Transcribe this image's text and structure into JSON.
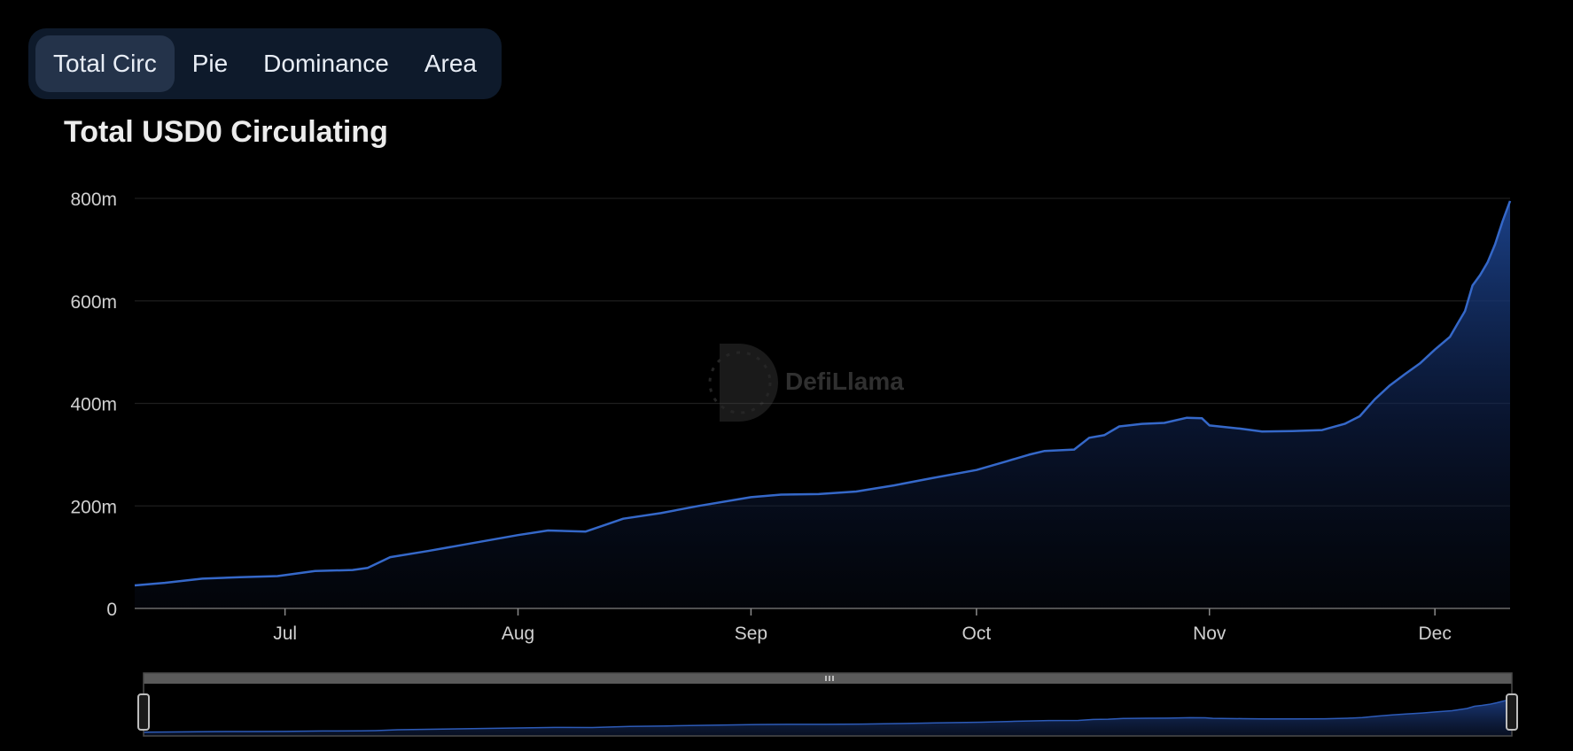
{
  "tabs": [
    {
      "label": "Total Circ",
      "active": true
    },
    {
      "label": "Pie",
      "active": false
    },
    {
      "label": "Dominance",
      "active": false
    },
    {
      "label": "Area",
      "active": false
    }
  ],
  "watermark": {
    "text": "DefiLlama"
  },
  "colors": {
    "background": "#000000",
    "line": "#3568c9",
    "area_top": "#1c448f",
    "tab_bg": "#0e1a2b",
    "tab_active_bg": "#24334a"
  },
  "chart_data": {
    "type": "area",
    "title": "Total USD0 Circulating",
    "xlabel": "",
    "ylabel": "",
    "x_ticks": [
      "Jul",
      "Aug",
      "Sep",
      "Oct",
      "Nov",
      "Dec"
    ],
    "y_ticks": [
      "0",
      "200m",
      "400m",
      "600m",
      "800m"
    ],
    "ylim": [
      0,
      800000000
    ],
    "xlim": [
      "2024-06-11",
      "2024-12-11"
    ],
    "grid": true,
    "legend": "none",
    "series": [
      {
        "x": [
          "2024-06-11",
          "2024-06-15",
          "2024-06-20",
          "2024-06-25",
          "2024-06-30",
          "2024-07-01",
          "2024-07-05",
          "2024-07-10",
          "2024-07-12",
          "2024-07-15",
          "2024-07-20",
          "2024-07-25",
          "2024-08-01",
          "2024-08-05",
          "2024-08-10",
          "2024-08-12",
          "2024-08-15",
          "2024-08-20",
          "2024-08-25",
          "2024-09-01",
          "2024-09-05",
          "2024-09-10",
          "2024-09-15",
          "2024-09-20",
          "2024-09-25",
          "2024-10-01",
          "2024-10-05",
          "2024-10-08",
          "2024-10-10",
          "2024-10-14",
          "2024-10-16",
          "2024-10-18",
          "2024-10-20",
          "2024-10-23",
          "2024-10-26",
          "2024-10-29",
          "2024-10-31",
          "2024-11-01",
          "2024-11-05",
          "2024-11-08",
          "2024-11-12",
          "2024-11-16",
          "2024-11-19",
          "2024-11-21",
          "2024-11-23",
          "2024-11-25",
          "2024-11-27",
          "2024-11-29",
          "2024-12-01",
          "2024-12-03",
          "2024-12-04",
          "2024-12-05",
          "2024-12-06",
          "2024-12-07",
          "2024-12-08",
          "2024-12-09",
          "2024-12-10",
          "2024-12-11"
        ],
        "values": [
          45000000,
          50000000,
          58000000,
          61000000,
          63000000,
          65000000,
          73000000,
          75000000,
          79000000,
          100000000,
          112000000,
          125000000,
          143000000,
          152000000,
          150000000,
          160000000,
          175000000,
          186000000,
          200000000,
          217000000,
          222000000,
          223000000,
          228000000,
          240000000,
          254000000,
          270000000,
          287000000,
          300000000,
          307000000,
          310000000,
          333000000,
          338000000,
          355000000,
          360000000,
          362000000,
          372000000,
          371000000,
          357000000,
          351000000,
          345000000,
          346000000,
          348000000,
          360000000,
          375000000,
          408000000,
          435000000,
          457000000,
          478000000,
          505000000,
          530000000,
          555000000,
          580000000,
          630000000,
          650000000,
          675000000,
          710000000,
          755000000,
          795000000
        ]
      }
    ]
  }
}
